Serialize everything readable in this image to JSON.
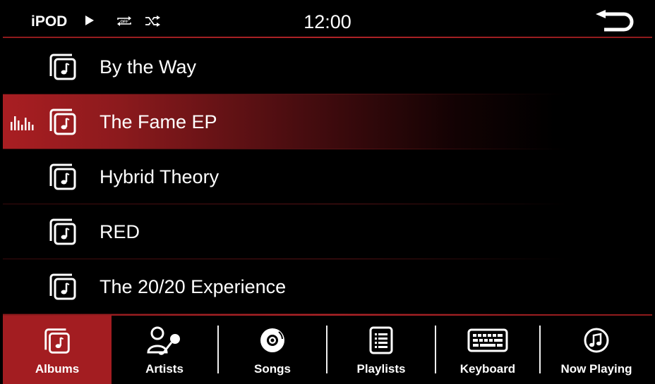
{
  "status_bar": {
    "source": "iPOD",
    "time": "12:00",
    "icons": [
      "play-icon",
      "repeat-off-icon",
      "shuffle-icon",
      "back-icon"
    ]
  },
  "albums": [
    {
      "title": "By the Way",
      "selected": false
    },
    {
      "title": "The Fame EP",
      "selected": true,
      "now_playing": true
    },
    {
      "title": "Hybrid Theory",
      "selected": false
    },
    {
      "title": "RED",
      "selected": false
    },
    {
      "title": "The 20/20 Experience",
      "selected": false
    }
  ],
  "nav": {
    "albums": "Albums",
    "artists": "Artists",
    "songs": "Songs",
    "playlists": "Playlists",
    "keyboard": "Keyboard",
    "now_playing": "Now Playing",
    "active": "albums"
  },
  "colors": {
    "accent": "#a31d21",
    "background": "#000000",
    "text": "#ffffff"
  }
}
